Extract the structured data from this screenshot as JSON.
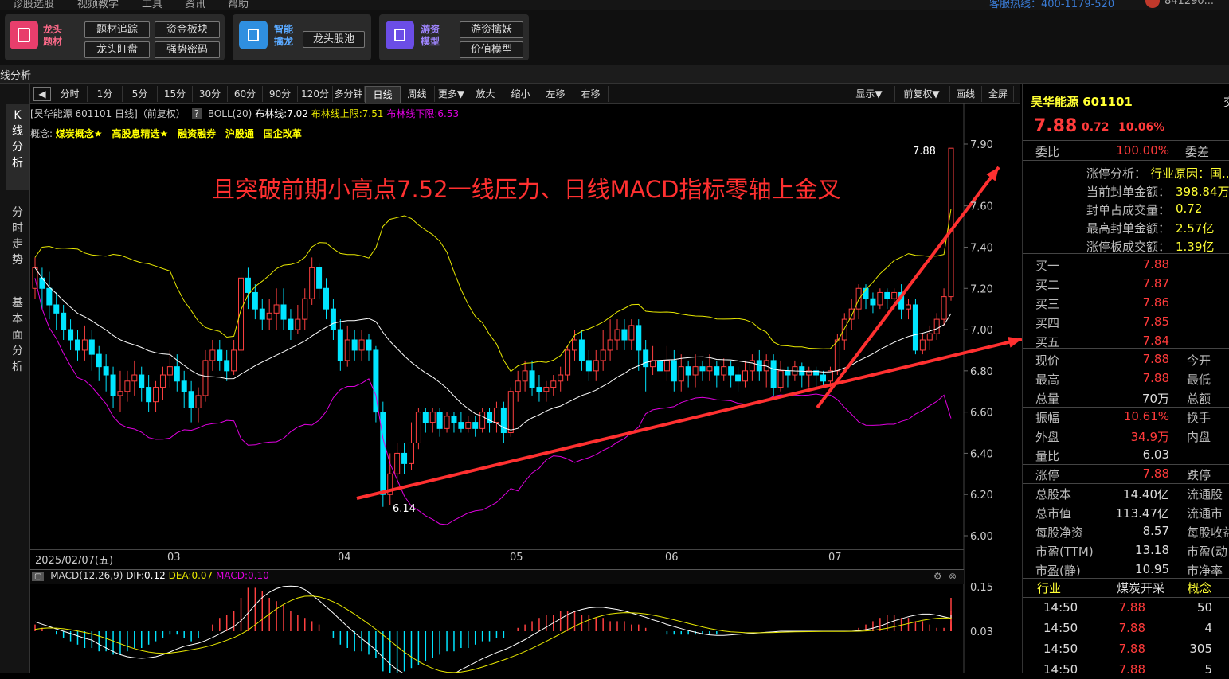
{
  "menu": {
    "items": [
      "诊股选股",
      "视频教学",
      "工具",
      "资讯",
      "帮助"
    ],
    "hotline": "客服热线：400-1179-520",
    "account": "841290..."
  },
  "toolbar": {
    "g1": {
      "name1": "龙头",
      "name2": "题材",
      "buttons": [
        "题材追踪",
        "资金板块",
        "龙头盯盘",
        "强势密码"
      ]
    },
    "g2": {
      "name1": "智能",
      "name2": "擒龙",
      "buttons": [
        "龙头股池"
      ]
    },
    "g3": {
      "name1": "游资",
      "name2": "模型",
      "buttons": [
        "游资擒妖",
        "价值模型"
      ]
    }
  },
  "window_title": "线分析",
  "left_tabs": [
    "K线分析",
    "分时走势",
    "基本面分析"
  ],
  "periods": [
    "分时",
    "1分",
    "5分",
    "15分",
    "30分",
    "60分",
    "90分",
    "120分",
    "多分钟",
    "日线",
    "周线",
    "更多▼",
    "放大",
    "缩小",
    "左移",
    "右移"
  ],
  "period_active": "日线",
  "right_controls": [
    "显示▼",
    "前复权▼",
    "画线",
    "全屏"
  ],
  "chart_header": {
    "title": "[昊华能源 601101 日线]（前复权）",
    "help": "?",
    "boll": "BOLL(20)",
    "mid": "布林线:7.02",
    "up": "布林线上限:7.51",
    "low": "布林线下限:6.53"
  },
  "concepts": {
    "label": "概念:",
    "items": [
      "煤炭概念★",
      "高股息精选★",
      "融资融券",
      "沪股通",
      "国企改革"
    ]
  },
  "annotation": "且突破前期小高点7.52一线压力、日线MACD指标零轴上金叉",
  "price_labels": {
    "high": "7.88",
    "low": "6.14"
  },
  "date_axis": [
    "2025/02/07(五)",
    "03",
    "04",
    "05",
    "06",
    "07"
  ],
  "macd_header": {
    "name": "MACD(12,26,9)",
    "dif": "DIF:0.12",
    "dea": "DEA:0.07",
    "macd": "MACD:0.10"
  },
  "colors": {
    "up": "#ff4040",
    "down": "#00e5ff",
    "boll_up": "#e8e800",
    "boll_mid": "#ffffff",
    "boll_low": "#e000e0",
    "annot": "#ff3030"
  },
  "chart_data": {
    "type": "candlestick",
    "y_ticks": [
      "7.90",
      "7.60",
      "7.40",
      "7.20",
      "7.00",
      "6.80",
      "6.60",
      "6.40",
      "6.20",
      "6.00"
    ],
    "ylim": [
      6.0,
      7.9
    ],
    "macd_ticks": [
      "0.15",
      "0.03"
    ],
    "candles": [
      [
        7.2,
        7.3,
        7.15,
        7.35
      ],
      [
        7.25,
        7.2,
        7.1,
        7.3
      ],
      [
        7.2,
        7.12,
        7.05,
        7.28
      ],
      [
        7.12,
        7.08,
        7.0,
        7.18
      ],
      [
        7.08,
        7.0,
        6.95,
        7.12
      ],
      [
        7.0,
        6.95,
        6.9,
        7.05
      ],
      [
        6.95,
        6.9,
        6.85,
        7.0
      ],
      [
        6.9,
        6.95,
        6.85,
        7.02
      ],
      [
        6.95,
        6.88,
        6.8,
        7.0
      ],
      [
        6.88,
        6.82,
        6.75,
        6.92
      ],
      [
        6.82,
        6.78,
        6.7,
        6.88
      ],
      [
        6.78,
        6.68,
        6.62,
        6.82
      ],
      [
        6.68,
        6.7,
        6.6,
        6.8
      ],
      [
        6.7,
        6.75,
        6.65,
        6.8
      ],
      [
        6.75,
        6.78,
        6.68,
        6.85
      ],
      [
        6.78,
        6.72,
        6.65,
        6.82
      ],
      [
        6.72,
        6.65,
        6.6,
        6.78
      ],
      [
        6.65,
        6.72,
        6.6,
        6.75
      ],
      [
        6.72,
        6.78,
        6.66,
        6.82
      ],
      [
        6.78,
        6.82,
        6.72,
        6.9
      ],
      [
        6.82,
        6.75,
        6.7,
        6.88
      ],
      [
        6.75,
        6.7,
        6.62,
        6.8
      ],
      [
        6.7,
        6.62,
        6.55,
        6.75
      ],
      [
        6.62,
        6.68,
        6.55,
        6.72
      ],
      [
        6.68,
        6.85,
        6.65,
        6.9
      ],
      [
        6.85,
        6.9,
        6.8,
        6.95
      ],
      [
        6.9,
        6.85,
        6.8,
        6.95
      ],
      [
        6.85,
        6.8,
        6.75,
        6.9
      ],
      [
        6.8,
        6.9,
        6.78,
        6.95
      ],
      [
        6.9,
        7.25,
        6.88,
        7.28
      ],
      [
        7.25,
        7.18,
        7.1,
        7.3
      ],
      [
        7.18,
        7.1,
        7.05,
        7.22
      ],
      [
        7.1,
        7.05,
        7.0,
        7.15
      ],
      [
        7.05,
        7.08,
        7.0,
        7.15
      ],
      [
        7.08,
        7.12,
        7.0,
        7.2
      ],
      [
        7.12,
        7.05,
        7.0,
        7.2
      ],
      [
        7.05,
        7.0,
        6.95,
        7.1
      ],
      [
        7.0,
        7.05,
        6.98,
        7.12
      ],
      [
        7.05,
        7.15,
        7.0,
        7.2
      ],
      [
        7.15,
        7.3,
        7.12,
        7.35
      ],
      [
        7.3,
        7.2,
        7.15,
        7.32
      ],
      [
        7.2,
        7.1,
        7.05,
        7.25
      ],
      [
        7.1,
        7.0,
        6.95,
        7.15
      ],
      [
        7.0,
        6.85,
        6.8,
        7.05
      ],
      [
        6.85,
        6.95,
        6.82,
        7.02
      ],
      [
        6.95,
        6.9,
        6.85,
        7.0
      ],
      [
        6.9,
        6.95,
        6.85,
        7.0
      ],
      [
        6.95,
        6.9,
        6.85,
        6.98
      ],
      [
        6.9,
        6.6,
        6.55,
        6.92
      ],
      [
        6.6,
        6.2,
        6.14,
        6.65
      ],
      [
        6.2,
        6.3,
        6.15,
        6.4
      ],
      [
        6.3,
        6.4,
        6.25,
        6.45
      ],
      [
        6.4,
        6.35,
        6.3,
        6.45
      ],
      [
        6.35,
        6.45,
        6.32,
        6.55
      ],
      [
        6.45,
        6.6,
        6.42,
        6.62
      ],
      [
        6.6,
        6.55,
        6.5,
        6.62
      ],
      [
        6.55,
        6.6,
        6.5,
        6.62
      ],
      [
        6.6,
        6.52,
        6.48,
        6.62
      ],
      [
        6.52,
        6.58,
        6.5,
        6.6
      ],
      [
        6.58,
        6.55,
        6.5,
        6.6
      ],
      [
        6.55,
        6.52,
        6.5,
        6.6
      ],
      [
        6.52,
        6.55,
        6.5,
        6.58
      ],
      [
        6.55,
        6.52,
        6.48,
        6.58
      ],
      [
        6.52,
        6.6,
        6.5,
        6.62
      ],
      [
        6.6,
        6.55,
        6.5,
        6.62
      ],
      [
        6.55,
        6.62,
        6.5,
        6.65
      ],
      [
        6.62,
        6.5,
        6.45,
        6.65
      ],
      [
        6.5,
        6.7,
        6.48,
        6.72
      ],
      [
        6.7,
        6.75,
        6.65,
        6.8
      ],
      [
        6.75,
        6.8,
        6.7,
        6.85
      ],
      [
        6.8,
        6.72,
        6.68,
        6.85
      ],
      [
        6.72,
        6.7,
        6.65,
        6.78
      ],
      [
        6.7,
        6.72,
        6.65,
        6.75
      ],
      [
        6.72,
        6.75,
        6.68,
        6.78
      ],
      [
        6.75,
        6.78,
        6.7,
        6.82
      ],
      [
        6.78,
        6.9,
        6.75,
        6.92
      ],
      [
        6.9,
        6.95,
        6.85,
        7.0
      ],
      [
        6.95,
        6.85,
        6.8,
        7.0
      ],
      [
        6.85,
        6.8,
        6.75,
        6.9
      ],
      [
        6.8,
        6.85,
        6.75,
        6.9
      ],
      [
        6.85,
        6.9,
        6.8,
        7.0
      ],
      [
        6.9,
        6.95,
        6.85,
        7.05
      ],
      [
        6.95,
        7.0,
        6.9,
        7.05
      ],
      [
        7.0,
        6.95,
        6.9,
        7.05
      ],
      [
        6.95,
        7.02,
        6.9,
        7.05
      ],
      [
        7.02,
        6.9,
        6.8,
        7.05
      ],
      [
        6.9,
        6.82,
        6.7,
        6.95
      ],
      [
        6.82,
        6.85,
        6.78,
        6.92
      ],
      [
        6.85,
        6.8,
        6.75,
        6.9
      ],
      [
        6.8,
        6.85,
        6.75,
        6.92
      ],
      [
        6.85,
        6.75,
        6.7,
        6.9
      ],
      [
        6.75,
        6.82,
        6.7,
        6.88
      ],
      [
        6.82,
        6.78,
        6.72,
        6.85
      ],
      [
        6.78,
        6.82,
        6.72,
        6.88
      ],
      [
        6.82,
        6.8,
        6.75,
        6.85
      ],
      [
        6.8,
        6.82,
        6.75,
        6.88
      ],
      [
        6.82,
        6.78,
        6.72,
        6.85
      ],
      [
        6.78,
        6.82,
        6.75,
        6.86
      ],
      [
        6.82,
        6.78,
        6.72,
        6.85
      ],
      [
        6.78,
        6.75,
        6.7,
        6.82
      ],
      [
        6.75,
        6.8,
        6.72,
        6.85
      ],
      [
        6.8,
        6.85,
        6.75,
        6.88
      ],
      [
        6.85,
        6.8,
        6.75,
        6.9
      ],
      [
        6.8,
        6.85,
        6.72,
        6.88
      ],
      [
        6.85,
        6.72,
        6.68,
        6.88
      ],
      [
        6.72,
        6.8,
        6.7,
        6.85
      ],
      [
        6.8,
        6.78,
        6.72,
        6.82
      ],
      [
        6.78,
        6.82,
        6.75,
        6.85
      ],
      [
        6.82,
        6.78,
        6.72,
        6.84
      ],
      [
        6.78,
        6.8,
        6.72,
        6.82
      ],
      [
        6.8,
        6.78,
        6.72,
        6.82
      ],
      [
        6.78,
        6.75,
        6.72,
        6.8
      ],
      [
        6.75,
        6.8,
        6.72,
        6.82
      ],
      [
        6.8,
        6.95,
        6.78,
        6.98
      ],
      [
        6.95,
        7.05,
        6.9,
        7.08
      ],
      [
        7.05,
        7.1,
        7.0,
        7.15
      ],
      [
        7.1,
        7.2,
        7.05,
        7.22
      ],
      [
        7.2,
        7.15,
        7.1,
        7.22
      ],
      [
        7.15,
        7.12,
        7.08,
        7.18
      ],
      [
        7.12,
        7.18,
        7.1,
        7.2
      ],
      [
        7.18,
        7.15,
        7.1,
        7.2
      ],
      [
        7.15,
        7.18,
        7.1,
        7.2
      ],
      [
        7.18,
        7.1,
        7.05,
        7.22
      ],
      [
        7.1,
        7.12,
        7.05,
        7.15
      ],
      [
        7.12,
        6.9,
        6.88,
        7.15
      ],
      [
        6.9,
        6.95,
        6.88,
        6.98
      ],
      [
        6.95,
        6.98,
        6.9,
        7.02
      ],
      [
        6.98,
        7.05,
        6.95,
        7.08
      ],
      [
        7.05,
        7.16,
        7.02,
        7.2
      ],
      [
        7.16,
        7.88,
        7.14,
        7.88
      ]
    ],
    "macd_hist": [
      0.02,
      0.01,
      0.0,
      -0.01,
      -0.02,
      -0.03,
      -0.04,
      -0.05,
      -0.05,
      -0.06,
      -0.06,
      -0.07,
      -0.07,
      -0.06,
      -0.05,
      -0.05,
      -0.04,
      -0.03,
      -0.02,
      -0.01,
      -0.01,
      -0.02,
      -0.03,
      -0.02,
      0.0,
      0.02,
      0.04,
      0.05,
      0.06,
      0.1,
      0.13,
      0.13,
      0.12,
      0.1,
      0.09,
      0.08,
      0.06,
      0.05,
      0.04,
      0.03,
      0.02,
      0.0,
      -0.02,
      -0.04,
      -0.05,
      -0.06,
      -0.06,
      -0.07,
      -0.08,
      -0.12,
      -0.13,
      -0.13,
      -0.12,
      -0.11,
      -0.1,
      -0.09,
      -0.08,
      -0.07,
      -0.06,
      -0.06,
      -0.05,
      -0.05,
      -0.04,
      -0.03,
      -0.03,
      -0.02,
      -0.02,
      0.0,
      0.01,
      0.02,
      0.03,
      0.04,
      0.05,
      0.05,
      0.06,
      0.06,
      0.06,
      0.05,
      0.05,
      0.04,
      0.04,
      0.03,
      0.03,
      0.03,
      0.02,
      0.02,
      0.01,
      0.0,
      0.0,
      -0.01,
      -0.01,
      -0.01,
      -0.01,
      -0.01,
      -0.01,
      -0.01,
      -0.01,
      0.0,
      0.0,
      0.0,
      0.0,
      0.0,
      0.0,
      0.0,
      0.0,
      0.0,
      0.0,
      0.0,
      0.0,
      0.0,
      0.0,
      0.0,
      0.0,
      0.0,
      0.0,
      0.0,
      0.01,
      0.02,
      0.03,
      0.04,
      0.05,
      0.05,
      0.04,
      0.04,
      0.03,
      0.03,
      0.02,
      0.01,
      0.01,
      0.02,
      0.03,
      0.06,
      0.1
    ]
  },
  "right": {
    "stock": "昊华能源 601101",
    "price": "7.88",
    "chg": "0.72",
    "pct": "10.06%",
    "weibi_label": "委比",
    "weibi_val": "100.00%",
    "weicha_label": "委差",
    "limit": [
      {
        "k": "涨停分析：",
        "v": "行业原因：国..."
      },
      {
        "k": "当前封单金额：",
        "v": "398.84万"
      },
      {
        "k": "封单占成交量：",
        "v": "0.72"
      },
      {
        "k": "最高封单金额：",
        "v": "2.57亿"
      },
      {
        "k": "涨停板成交额：",
        "v": "1.39亿"
      }
    ],
    "bids": [
      {
        "k": "买一",
        "v": "7.88"
      },
      {
        "k": "买二",
        "v": "7.87"
      },
      {
        "k": "买三",
        "v": "7.86"
      },
      {
        "k": "买四",
        "v": "7.85"
      },
      {
        "k": "买五",
        "v": "7.84"
      }
    ],
    "quote": [
      {
        "k": "现价",
        "v": "7.88",
        "c": "red",
        "k2": "今开"
      },
      {
        "k": "最高",
        "v": "7.88",
        "c": "red",
        "k2": "最低"
      },
      {
        "k": "总量",
        "v": "70万",
        "c": "wht",
        "k2": "总额"
      },
      {
        "k": "振幅",
        "v": "10.61%",
        "c": "red",
        "k2": "换手"
      },
      {
        "k": "外盘",
        "v": "34.9万",
        "c": "red",
        "k2": "内盘"
      },
      {
        "k": "量比",
        "v": "6.03",
        "c": "wht",
        "k2": ""
      },
      {
        "k": "涨停",
        "v": "7.88",
        "c": "red",
        "k2": "跌停"
      },
      {
        "k": "总股本",
        "v": "14.40亿",
        "c": "wht",
        "k2": "流通股"
      },
      {
        "k": "总市值",
        "v": "113.47亿",
        "c": "wht",
        "k2": "流通市"
      },
      {
        "k": "每股净资",
        "v": "8.57",
        "c": "wht",
        "k2": "每股收益"
      },
      {
        "k": "市盈(TTM)",
        "v": "13.18",
        "c": "wht",
        "k2": "市盈(动"
      },
      {
        "k": "市盈(静)",
        "v": "10.95",
        "c": "wht",
        "k2": "市净率"
      }
    ],
    "industry": {
      "k": "行业",
      "v": "煤炭开采",
      "k2": "概念"
    },
    "ticks": [
      {
        "t": "14:50",
        "p": "7.88",
        "v": "50"
      },
      {
        "t": "14:50",
        "p": "7.88",
        "v": "4"
      },
      {
        "t": "14:50",
        "p": "7.88",
        "v": "305"
      },
      {
        "t": "14:50",
        "p": "7.88",
        "v": "5"
      }
    ],
    "cut": "交"
  }
}
